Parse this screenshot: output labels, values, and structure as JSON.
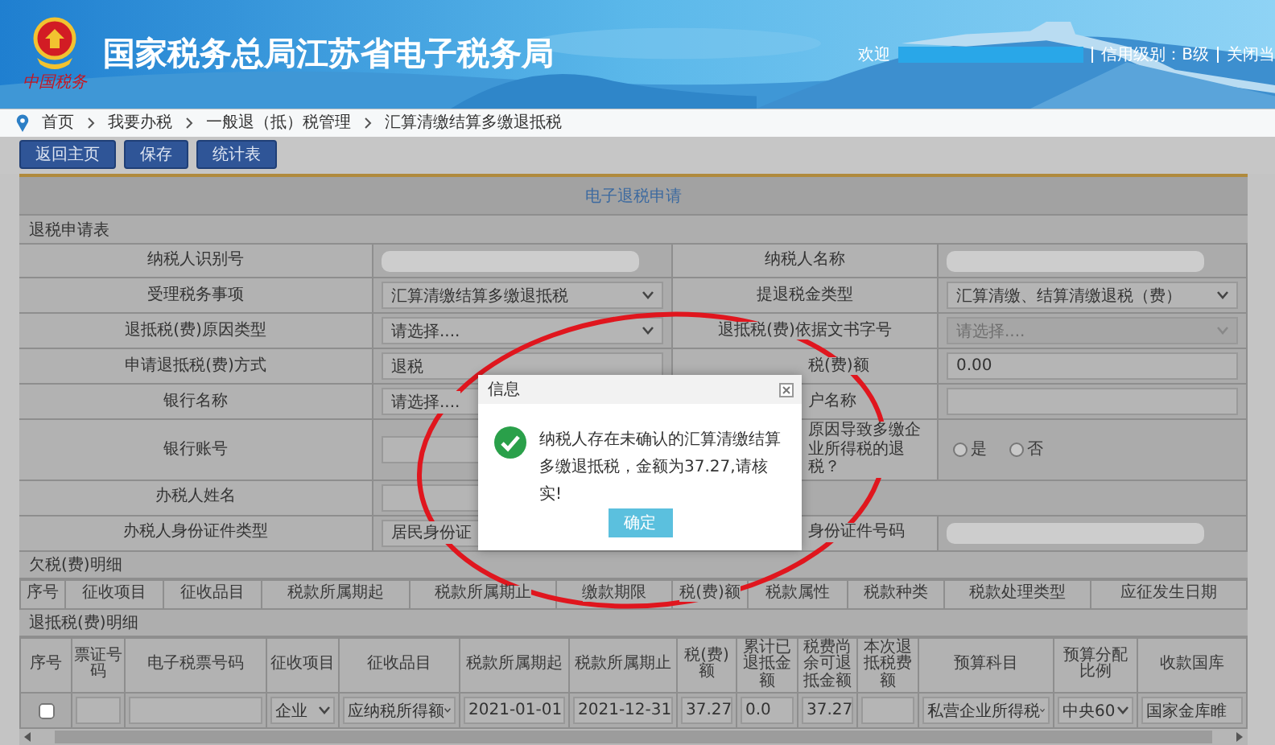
{
  "header": {
    "title": "国家税务总局江苏省电子税务局",
    "logo_text": "中国税务",
    "welcome": "欢迎",
    "credit": "信用级别：B级",
    "close_link": "关闭当"
  },
  "breadcrumb": [
    "首页",
    "我要办税",
    "一般退（抵）税管理",
    "汇算清缴结算多缴退抵税"
  ],
  "toolbar": [
    "返回主页",
    "保存",
    "统计表"
  ],
  "panel": {
    "title": "电子退税申请",
    "section": "退税申请表",
    "rows": [
      {
        "left": {
          "label": "纳税人识别号",
          "value": {
            "kind": "redacted"
          }
        },
        "right": {
          "label": "纳税人名称",
          "value": {
            "kind": "redacted"
          }
        }
      },
      {
        "left": {
          "label": "受理税务事项",
          "value": {
            "kind": "select",
            "text": "汇算清缴结算多缴退抵税"
          }
        },
        "right": {
          "label": "提退税金类型",
          "value": {
            "kind": "select",
            "text": "汇算清缴、结算清缴退税（费）"
          }
        }
      },
      {
        "left": {
          "label": "退抵税(费)原因类型",
          "value": {
            "kind": "select",
            "text": "请选择...."
          }
        },
        "right": {
          "label": "退抵税(费)依据文书字号",
          "value": {
            "kind": "select",
            "text": "请选择....",
            "disabled": true
          }
        }
      },
      {
        "left": {
          "label": "申请退抵税(费)方式",
          "value": {
            "kind": "input",
            "text": "退税"
          }
        },
        "right": {
          "label": "税(费)额",
          "clipped": true,
          "value": {
            "kind": "input",
            "text": "0.00"
          }
        }
      },
      {
        "left": {
          "label": "银行名称",
          "value": {
            "kind": "input",
            "text": "请选择...."
          }
        },
        "right": {
          "label": "户名称",
          "clipped": true,
          "value": {
            "kind": "input"
          }
        }
      },
      {
        "left": {
          "label": "银行账号",
          "value": {
            "kind": "input"
          }
        },
        "right": {
          "label": "原因导致多缴企业所得税的退税？",
          "clipped": true,
          "value": {
            "kind": "radio",
            "options": [
              {
                "label": "是",
                "selected": false
              },
              {
                "label": "否",
                "selected": false
              }
            ]
          }
        }
      },
      {
        "left": {
          "label": "办税人姓名",
          "value": {
            "kind": "input"
          }
        }
      },
      {
        "left": {
          "label": "办税人身份证件类型",
          "value": {
            "kind": "input",
            "text": "居民身份证"
          }
        },
        "right": {
          "label": "身份证件号码",
          "clipped": true,
          "value": {
            "kind": "redacted"
          }
        }
      }
    ]
  },
  "arrears": {
    "title": "欠税(费)明细",
    "columns": [
      "序号",
      "征收项目",
      "征收品目",
      "税款所属期起",
      "税款所属期止",
      "缴款期限",
      "税(费)额",
      "税款属性",
      "税款种类",
      "税款处理类型",
      "应征发生日期"
    ]
  },
  "refunds": {
    "title": "退抵税(费)明细",
    "columns": [
      "序号",
      "票证号码",
      "电子税票号码",
      "征收项目",
      "征收品目",
      "税款所属期起",
      "税款所属期止",
      "税(费)额",
      "累计已退抵金额",
      "税费尚余可退抵金额",
      "本次退抵税费额",
      "预算科目",
      "预算分配比例",
      "收款国库"
    ],
    "rows": [
      [
        {
          "kind": "checkbox",
          "checked": false
        },
        {
          "kind": "input"
        },
        {
          "kind": "input"
        },
        {
          "kind": "select",
          "text": "企业"
        },
        {
          "kind": "select",
          "text": "应纳税所得额"
        },
        {
          "kind": "input",
          "text": "2021-01-01"
        },
        {
          "kind": "input",
          "text": "2021-12-31"
        },
        {
          "kind": "input",
          "text": "37.27"
        },
        {
          "kind": "input",
          "text": "0.0"
        },
        {
          "kind": "input",
          "text": "37.27"
        },
        {
          "kind": "input"
        },
        {
          "kind": "select",
          "text": "私营企业所得税"
        },
        {
          "kind": "select",
          "text": "中央60"
        },
        {
          "kind": "input",
          "text": "国家金库睢"
        }
      ]
    ]
  },
  "dialog": {
    "title": "信息",
    "message": "纳税人存在未确认的汇算清缴结算多缴退抵税，金额为37.27,请核实!",
    "button": "确定"
  }
}
